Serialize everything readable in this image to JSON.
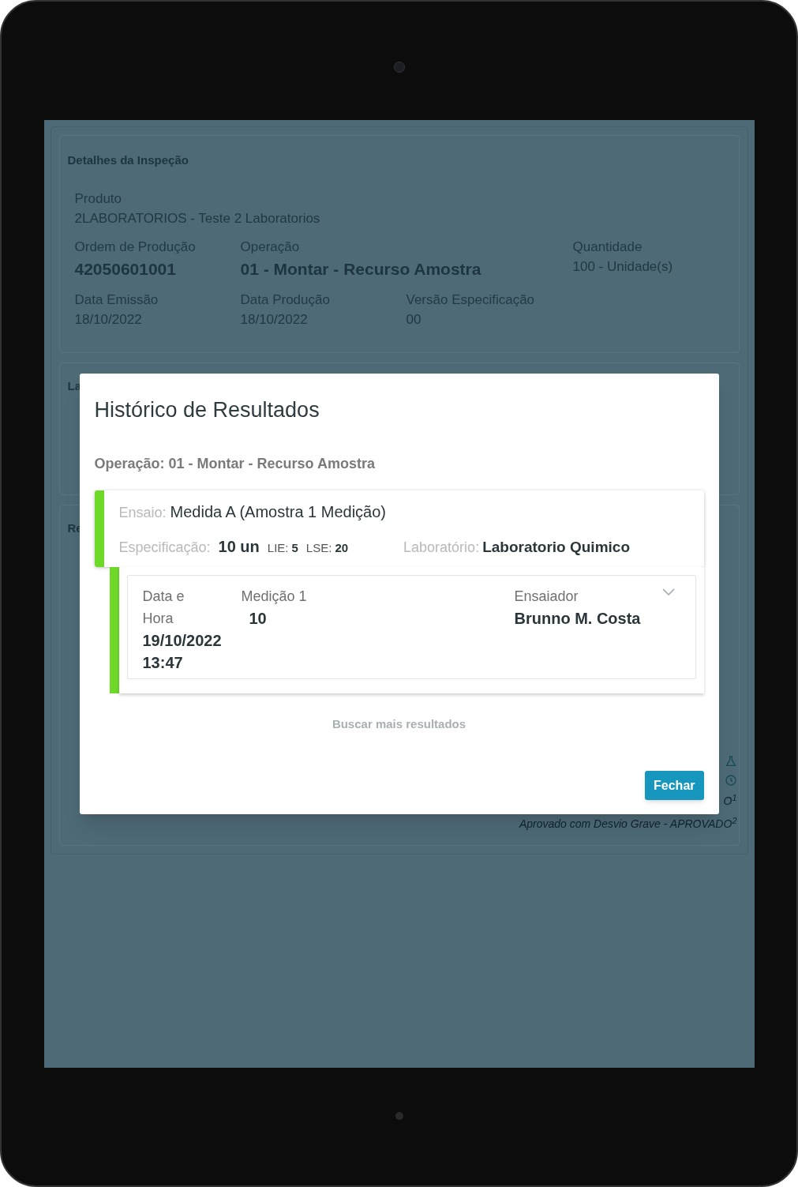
{
  "inspection_details": {
    "title": "Detalhes da Inspeção",
    "fields": [
      {
        "label": "Produto",
        "value": "2LABORATORIOS - Teste 2 Laboratorios",
        "emphasis": false
      },
      {
        "label": "Ordem de Produção",
        "value": "42050601001",
        "emphasis": true
      },
      {
        "label": "Operação",
        "value": "01 - Montar - Recurso Amostra",
        "emphasis": true
      },
      {
        "label": "Quantidade",
        "value": "100 - Unidade(s)",
        "emphasis": false
      },
      {
        "label": "Data Emissão",
        "value": "18/10/2022",
        "emphasis": false
      },
      {
        "label": "Data Produção",
        "value": "18/10/2022",
        "emphasis": false
      },
      {
        "label": "Versão Especificação",
        "value": "00",
        "emphasis": false
      }
    ]
  },
  "background_sections": [
    {
      "title_fragment": "La"
    },
    {
      "title_fragment": "Re"
    }
  ],
  "background_legend": [
    "O$^{1}$",
    "Aprovado com Desvio Grave - APROVADO$^{2}$"
  ],
  "modal": {
    "title": "Histórico de Resultados",
    "operation": "Operação: 01 - Montar - Recurso Amostra",
    "test": {
      "label": "Ensaio:",
      "name": "Medida A (Amostra 1 Medição)",
      "spec_label": "Especificação:",
      "spec_value": "10 un",
      "lie_label": "LIE:",
      "lie_value": "5",
      "lse_label": "LSE:",
      "lse_value": "20",
      "lab_label": "Laboratório:",
      "lab_value": "Laboratorio Quimico",
      "color": "#6fd92a"
    },
    "results": [
      {
        "date_label": "Data e Hora",
        "date_value": "19/10/2022 13:47",
        "measure_label": "Medição 1",
        "measure_value": "10",
        "tester_label": "Ensaiador",
        "tester_value": "Brunno M. Costa",
        "color": "#6fd92a"
      }
    ],
    "load_more": "Buscar mais resultados",
    "close_button": "Fechar"
  }
}
